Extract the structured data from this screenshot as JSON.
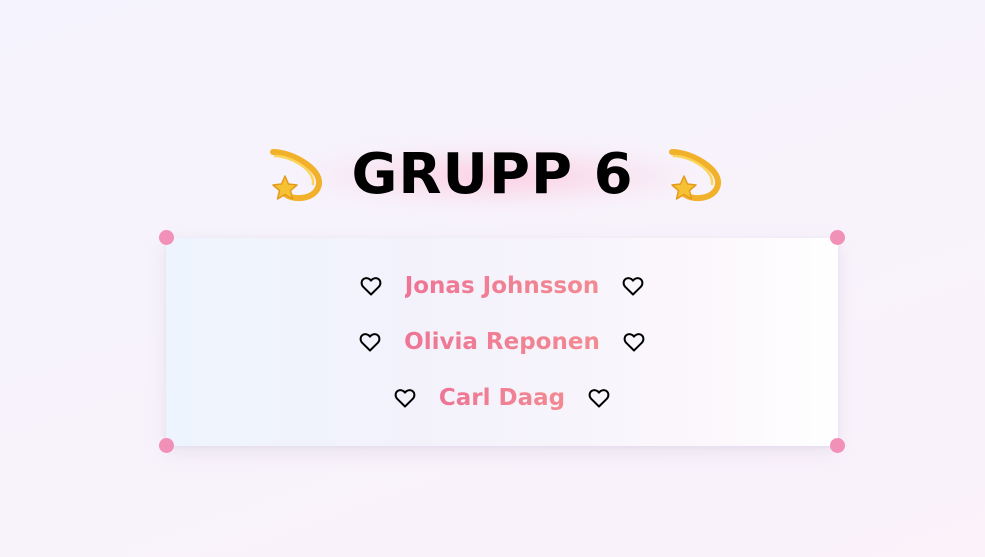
{
  "title": {
    "text": "GRUPP 6",
    "left_icon": "dizzy-star-icon",
    "right_icon": "dizzy-star-icon"
  },
  "members": [
    {
      "name": "Jonas Johnsson",
      "left_icon": "heart-outline-icon",
      "right_icon": "heart-outline-icon"
    },
    {
      "name": "Olivia Reponen",
      "left_icon": "heart-outline-icon",
      "right_icon": "heart-outline-icon"
    },
    {
      "name": "Carl Daag",
      "left_icon": "heart-outline-icon",
      "right_icon": "heart-outline-icon"
    }
  ],
  "colors": {
    "name_text": "#ef7a93",
    "corner_dots": "#f291b8",
    "title_text": "#000000"
  }
}
